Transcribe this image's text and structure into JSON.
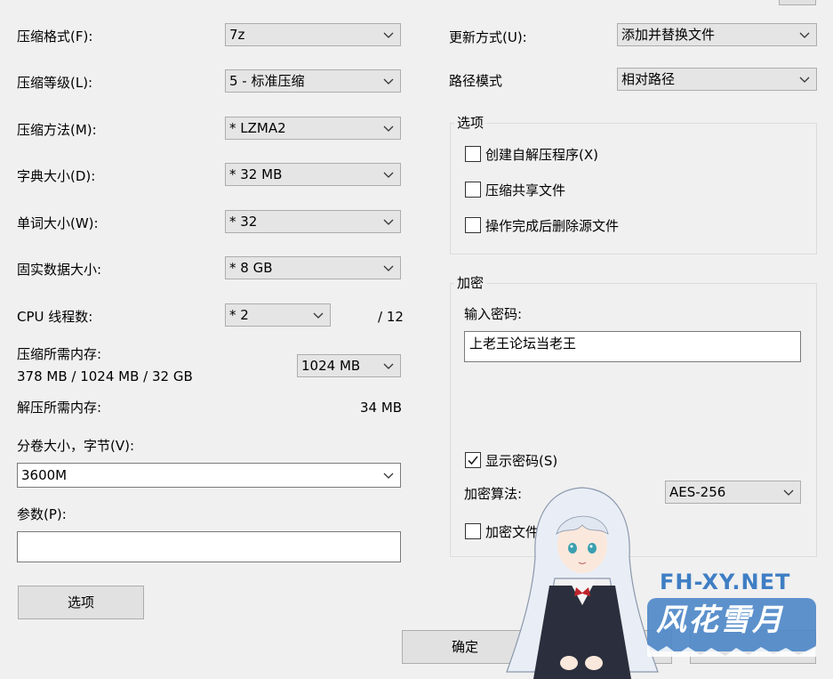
{
  "left": {
    "format_label": "压缩格式(F):",
    "format_value": "7z",
    "level_label": "压缩等级(L):",
    "level_value": "5 - 标准压缩",
    "method_label": "压缩方法(M):",
    "method_value": "*  LZMA2",
    "dict_label": "字典大小(D):",
    "dict_value": "*  32 MB",
    "word_label": "单词大小(W):",
    "word_value": "*  32",
    "solid_label": "固实数据大小:",
    "solid_value": "*  8 GB",
    "threads_label": "CPU 线程数:",
    "threads_value": "*  2",
    "threads_total": "/ 12",
    "mem_compress_label": "压缩所需内存:",
    "mem_compress_detail": "378 MB / 1024 MB / 32 GB",
    "mem_limit_value": "1024 MB",
    "mem_decompress_label": "解压所需内存:",
    "mem_decompress_value": "34 MB",
    "volume_label": "分卷大小，字节(V):",
    "volume_value": "3600M",
    "params_label": "参数(P):",
    "params_value": "",
    "options_button": "选项"
  },
  "right": {
    "update_label": "更新方式(U):",
    "update_value": "添加并替换文件",
    "path_label": "路径模式",
    "path_value": "相对路径",
    "options_group": {
      "title": "选项",
      "items": [
        {
          "label": "创建自解压程序(X)",
          "checked": false
        },
        {
          "label": "压缩共享文件",
          "checked": false
        },
        {
          "label": "操作完成后删除源文件",
          "checked": false
        }
      ]
    },
    "encryption": {
      "title": "加密",
      "password_label": "输入密码:",
      "password_value": "上老王论坛当老王",
      "show_password": {
        "label": "显示密码(S)",
        "checked": true
      },
      "algo_label": "加密算法:",
      "algo_value": "AES-256",
      "encrypt_names": {
        "label": "加密文件名",
        "checked": false
      }
    }
  },
  "footer": {
    "ok_button": "确定"
  },
  "watermark": {
    "site": "FH-XY.NET",
    "brand": "风花雪月"
  },
  "colors": {
    "window_bg": "#f0f0f0",
    "combo_bg": "#e5e5e5",
    "watermark_blue": "#3f7ec4"
  }
}
